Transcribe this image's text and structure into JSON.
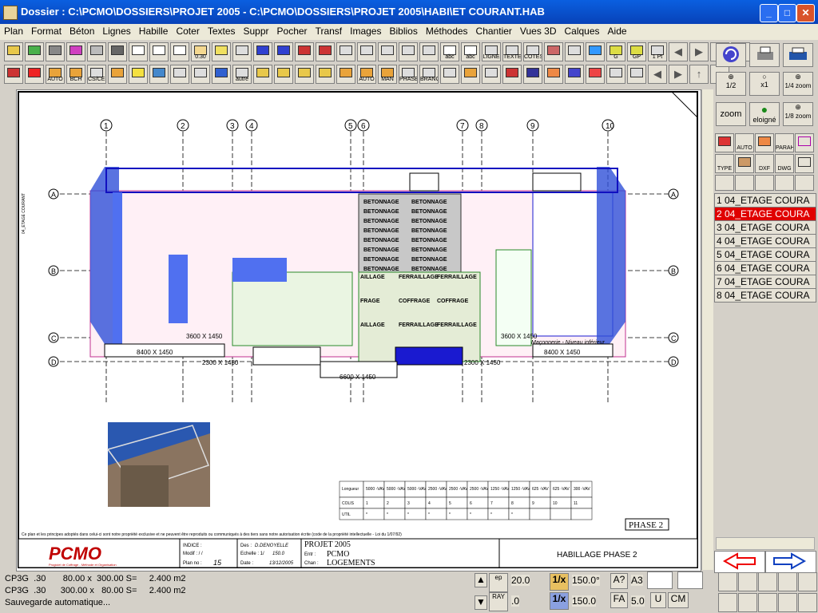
{
  "window": {
    "title": "Dossier : C:\\PCMO\\DOSSIERS\\PROJET 2005 - C:\\PCMO\\DOSSIERS\\PROJET 2005\\HABI\\ET COURANT.HAB"
  },
  "menu": [
    "Plan",
    "Format",
    "Béton",
    "Lignes",
    "Habille",
    "Coter",
    "Textes",
    "Suppr",
    "Pocher",
    "Transf",
    "Images",
    "Biblios",
    "Méthodes",
    "Chantier",
    "Vues 3D",
    "Calques",
    "Aide"
  ],
  "toolbar": {
    "row1_labels": [
      "",
      "",
      "",
      "",
      "",
      "",
      "",
      "",
      "",
      "0.30",
      "",
      "",
      "",
      "",
      "",
      "",
      "",
      "",
      "",
      "",
      "",
      "abc",
      "abc",
      "LIGNE",
      "TEXTE",
      "COTES",
      "",
      "",
      "",
      "G",
      "GP",
      "1 Pt"
    ],
    "row2_labels": [
      "",
      "",
      "AUTO",
      "BCH",
      "CS/CE CPS",
      "",
      "",
      "",
      "",
      "",
      "",
      "autre",
      "",
      "",
      "",
      "",
      "",
      "AUTO",
      "MAN",
      "PHASE",
      "BRANCH PHASE",
      "",
      "",
      "",
      "",
      "",
      "",
      "",
      "",
      "",
      ""
    ]
  },
  "right_tools": {
    "zoom_half": "1/2",
    "zoom_x1": "x1",
    "zoom_quarter": "1/4\nzoom",
    "zoom_label": "zoom",
    "eloigne": "eloigné",
    "zoom_eighth": "1/8\nzoom",
    "auto": "AUTO",
    "paran": "PARAH",
    "type": "TYPE",
    "dxf": "DXF",
    "dwg": "DWG",
    "abc": "abc"
  },
  "layers": [
    {
      "label": "1 04_ETAGE COURA",
      "active": false
    },
    {
      "label": "2 04_ETAGE COURA",
      "active": true
    },
    {
      "label": "3 04_ETAGE COURA",
      "active": false
    },
    {
      "label": "4 04_ETAGE COURA",
      "active": false
    },
    {
      "label": "5 04_ETAGE COURA",
      "active": false
    },
    {
      "label": "6 04_ETAGE COURA",
      "active": false
    },
    {
      "label": "7 04_ETAGE COURA",
      "active": false
    },
    {
      "label": "8 04_ETAGE COURA",
      "active": false
    }
  ],
  "drawing": {
    "col_axes": [
      "1",
      "2",
      "3",
      "4",
      "5",
      "6",
      "7",
      "8",
      "9",
      "10"
    ],
    "row_axes": [
      "A",
      "B",
      "C",
      "D"
    ],
    "betonnage_label": "BETONNAGE",
    "zone_labels": [
      "AILLAGE",
      "FERRAILLAGE",
      "FERRAILLAGE",
      "FRAGE",
      "COFFRAGE",
      "COFFRAGE",
      "AILLAGE",
      "FERRAILLAGE",
      "FERRAILLAGE"
    ],
    "dim_labels": [
      "8400 X 1450",
      "6600 X 1450",
      "8400 X 1450",
      "3600 X 1450",
      "3600 X 1450",
      "2300 X 1450",
      "2300 X 1450"
    ],
    "maconnerie": "Maçonnerie - Niveau inférieur",
    "vertical_note": "04_ETAGE COURANT",
    "legal": "Ce plan et les principes adoptés dans celui-ci sont notre propriété exclusive et ne peuvent être reproduits ou communiqués à des tiers sans notre autorisation écrite (code de la propriété intellectuelle - Loi du 1/07/92)",
    "phase": "PHASE 2",
    "table": {
      "headers": [
        "Longueur",
        "5000 -VAV",
        "5000 -VAV",
        "5000 -VAV",
        "2500 -VAV",
        "2500 -VAV",
        "2500 -VAV",
        "1250 -VAV",
        "1250 -VAV",
        "625 -VAV",
        "625 -VAV",
        "300 -VAV"
      ],
      "row_colis": [
        "COLIS",
        "1",
        "2",
        "3",
        "4",
        "5",
        "6",
        "7",
        "8",
        "9",
        "10",
        "11"
      ],
      "row_util": [
        "UTIL",
        "*",
        "*",
        "*",
        "*",
        "*",
        "*",
        "*",
        "*",
        "",
        "",
        ""
      ]
    },
    "cartouche": {
      "logo": "PCMO",
      "logo_sub": "Progiciel de Coffrage - Méthode et Organisation",
      "indice": "INDICE :",
      "modif": "Modif :  /  /",
      "plan_no_label": "Plan no :",
      "plan_no": "15",
      "des_label": "Des :",
      "des": "D.DENOYELLE",
      "echelle_label": "Echelle : 1/",
      "echelle": "150.0",
      "date_label": "Date :",
      "date": "13/12/2005",
      "project": "PROJET 2005",
      "entr_label": "Entr :",
      "entr": "PCMO",
      "chan_label": "Chan :",
      "chan": "LOGEMENTS",
      "title": "HABILLAGE PHASE 2"
    }
  },
  "status": {
    "line1": "CP3G  .30       80.00 x  300.00 S=     2.400 m2",
    "line2": "CP3G  .30      300.00 x   80.00 S=     2.400 m2",
    "line3": "Sauvegarde automatique..."
  },
  "controls": {
    "ep_label": "ep",
    "ep_value": "20.0",
    "ray_label": "RAY",
    "ray_value": ".0",
    "scale_btn": "1/x",
    "scale_value": "150.0°",
    "scale_btn2": "1/x",
    "scale_value2": "150.0",
    "help": "A?",
    "paper": "A3",
    "fa_label": "FA",
    "fa_value": "5.0",
    "unit_u": "U",
    "unit_cm": "CM"
  }
}
